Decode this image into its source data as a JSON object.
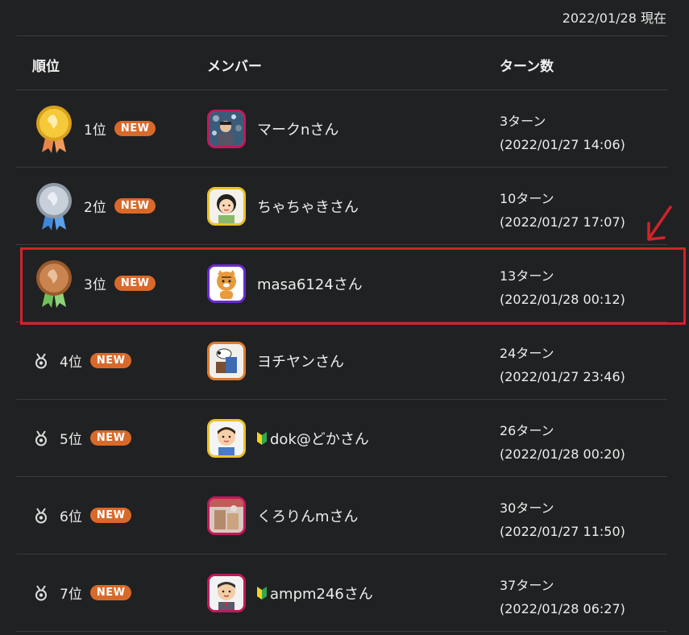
{
  "as_of": "2022/01/28 現在",
  "headers": {
    "rank": "順位",
    "member": "メンバー",
    "turns": "ターン数"
  },
  "new_badge": "NEW",
  "colors": {
    "background": "#202122",
    "badge": "#d9692a",
    "highlight": "#d2232a"
  },
  "rows": [
    {
      "rank": "1位",
      "medal": "gold-medal-icon",
      "name": "マークnさん",
      "beginner": false,
      "turns": "3ターン",
      "time": "(2022/01/27 14:06)",
      "avatar_border": "#c2185b"
    },
    {
      "rank": "2位",
      "medal": "silver-medal-icon",
      "name": "ちゃちゃきさん",
      "beginner": false,
      "turns": "10ターン",
      "time": "(2022/01/27 17:07)",
      "avatar_border": "#e8c22a"
    },
    {
      "rank": "3位",
      "medal": "bronze-medal-icon",
      "name": "masa6124さん",
      "beginner": false,
      "turns": "13ターン",
      "time": "(2022/01/28 00:12)",
      "avatar_border": "#6a2bd1"
    },
    {
      "rank": "4位",
      "medal": "small-medal-icon",
      "name": "ヨチヤンさん",
      "beginner": false,
      "turns": "24ターン",
      "time": "(2022/01/27 23:46)",
      "avatar_border": "#e07a2e"
    },
    {
      "rank": "5位",
      "medal": "small-medal-icon",
      "name": "dok@どかさん",
      "beginner": true,
      "turns": "26ターン",
      "time": "(2022/01/28 00:20)",
      "avatar_border": "#e8c22a"
    },
    {
      "rank": "6位",
      "medal": "small-medal-icon",
      "name": "くろりんmさん",
      "beginner": false,
      "turns": "30ターン",
      "time": "(2022/01/27 11:50)",
      "avatar_border": "#c2185b"
    },
    {
      "rank": "7位",
      "medal": "small-medal-icon",
      "name": "ampm246さん",
      "beginner": true,
      "turns": "37ターン",
      "time": "(2022/01/28 06:27)",
      "avatar_border": "#c2185b"
    }
  ]
}
